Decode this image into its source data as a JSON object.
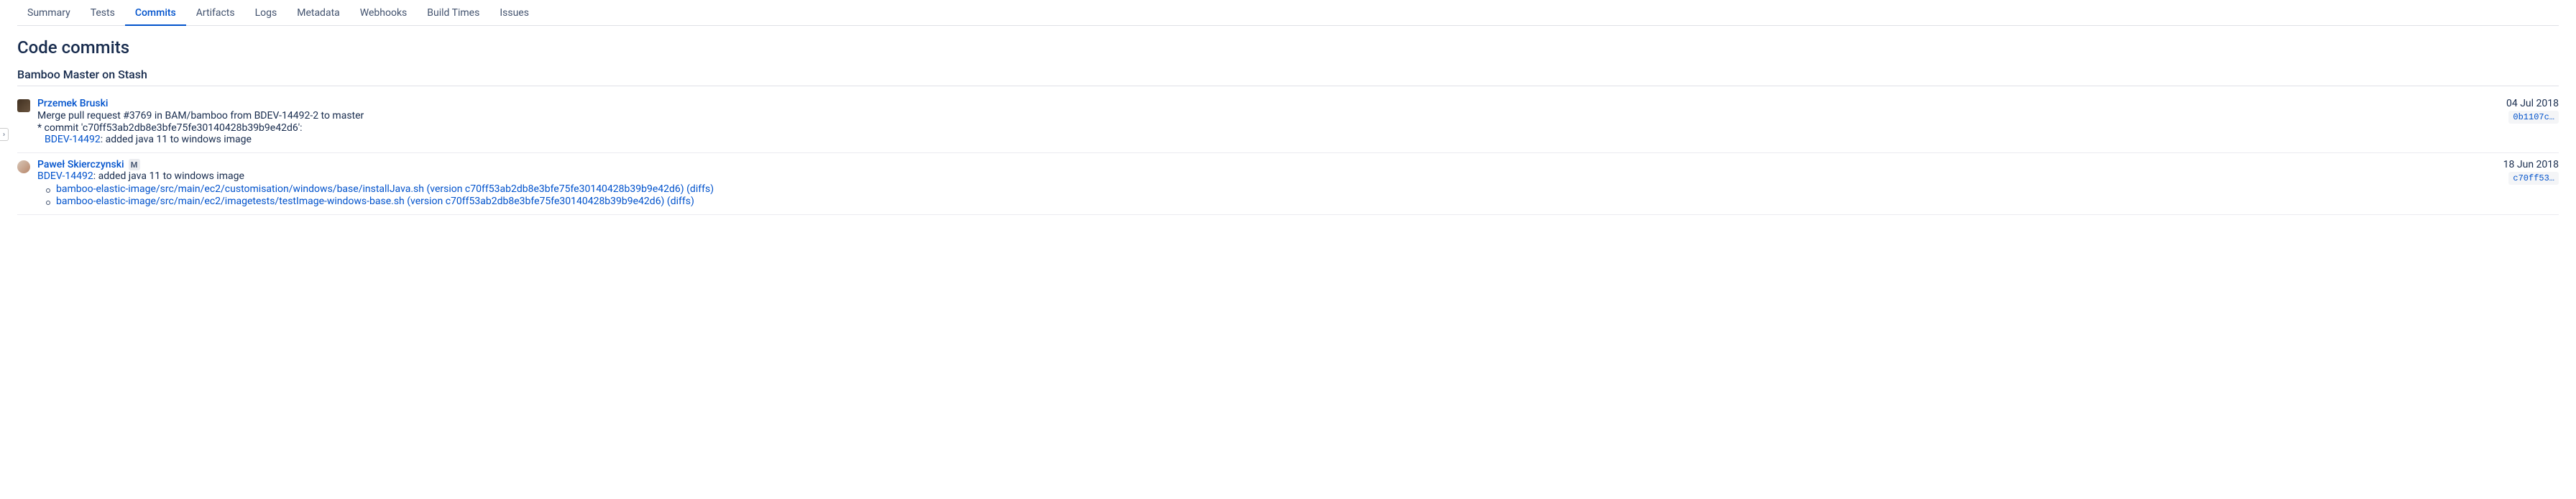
{
  "tabs": [
    "Summary",
    "Tests",
    "Commits",
    "Artifacts",
    "Logs",
    "Metadata",
    "Webhooks",
    "Build Times",
    "Issues"
  ],
  "active_tab_index": 2,
  "page_title": "Code commits",
  "section_title": "Bamboo Master on Stash",
  "commits": [
    {
      "author": "Przemek Bruski",
      "merge_badge": false,
      "message": "Merge pull request #3769 in BAM/bamboo from BDEV-14492-2 to master",
      "sub_prefix": "* commit 'c70ff53ab2db8e3bfe75fe30140428b39b9e42d6':",
      "issue_key": "BDEV-14492",
      "issue_suffix": ": added java 11 to windows image",
      "date": "04 Jul 2018",
      "hash": "0b1107c…",
      "files": []
    },
    {
      "author": "Paweł Skierczynski",
      "merge_badge": true,
      "merge_badge_label": "M",
      "issue_key": "BDEV-14492",
      "issue_suffix": ": added java 11 to windows image",
      "date": "18 Jun 2018",
      "hash": "c70ff53…",
      "files": [
        {
          "path": "bamboo-elastic-image/src/main/ec2/customisation/windows/base/installJava.sh (version c70ff53ab2db8e3bfe75fe30140428b39b9e42d6)",
          "diffs": "(diffs)"
        },
        {
          "path": "bamboo-elastic-image/src/main/ec2/imagetests/testImage-windows-base.sh (version c70ff53ab2db8e3bfe75fe30140428b39b9e42d6)",
          "diffs": "(diffs)"
        }
      ]
    }
  ]
}
